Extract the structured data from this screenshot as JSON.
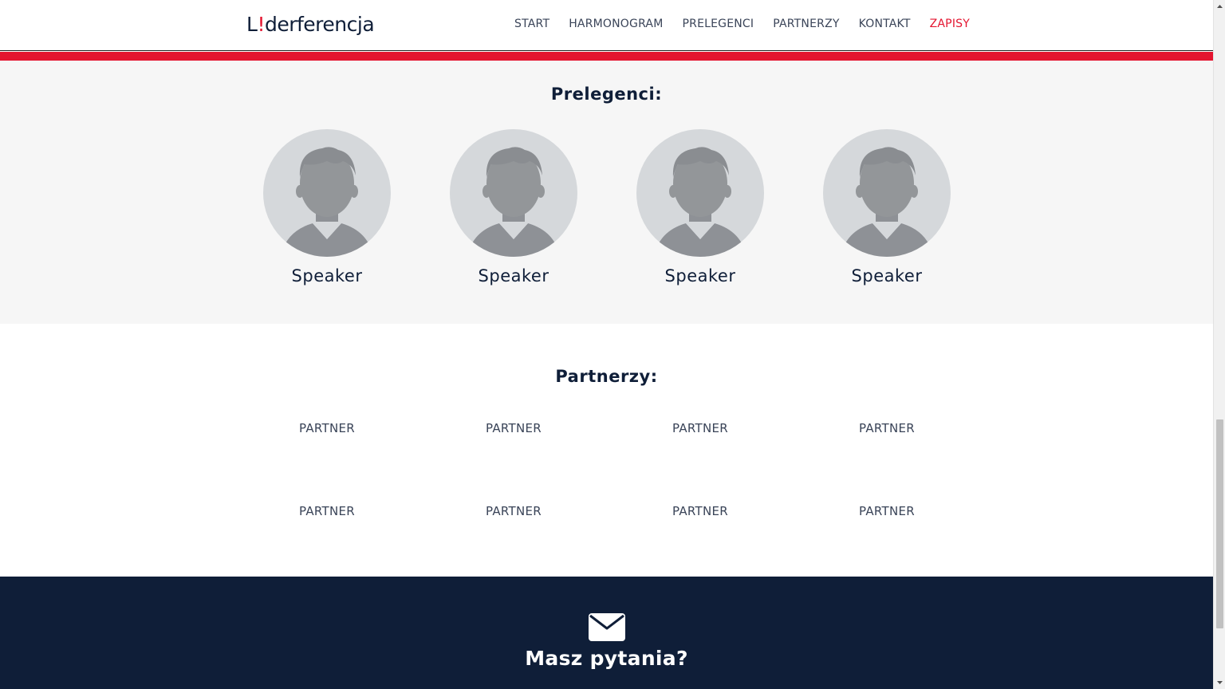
{
  "header": {
    "logo": {
      "prefix": "L",
      "bang": "!",
      "suffix": "derferencja"
    },
    "nav": [
      {
        "label": "START"
      },
      {
        "label": "HARMONOGRAM"
      },
      {
        "label": "PRELEGENCI"
      },
      {
        "label": "PARTNERZY"
      },
      {
        "label": "KONTAKT"
      },
      {
        "label": "ZAPISY",
        "accent": true
      }
    ]
  },
  "speakers": {
    "title": "Prelegenci:",
    "items": [
      {
        "name": "Speaker"
      },
      {
        "name": "Speaker"
      },
      {
        "name": "Speaker"
      },
      {
        "name": "Speaker"
      }
    ]
  },
  "partners": {
    "title": "Partnerzy:",
    "items": [
      {
        "label": "PARTNER"
      },
      {
        "label": "PARTNER"
      },
      {
        "label": "PARTNER"
      },
      {
        "label": "PARTNER"
      },
      {
        "label": "PARTNER"
      },
      {
        "label": "PARTNER"
      },
      {
        "label": "PARTNER"
      },
      {
        "label": "PARTNER"
      }
    ]
  },
  "contact": {
    "icon": "envelope-icon",
    "title": "Masz pytania?"
  },
  "colors": {
    "accent": "#e4142f",
    "navy": "#0f1e38",
    "light_bg": "#f6f6f6"
  }
}
